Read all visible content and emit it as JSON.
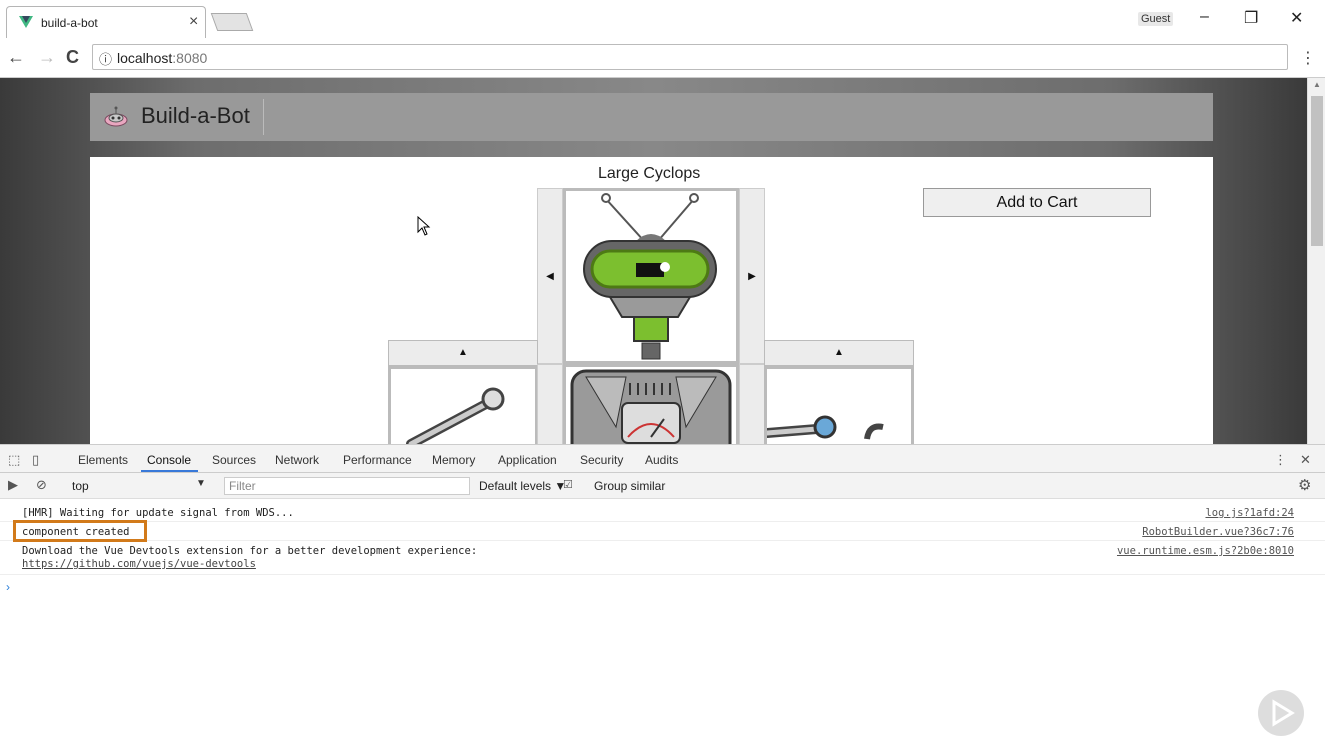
{
  "browser": {
    "tab_title": "build-a-bot",
    "tab_close": "×",
    "profile": "Guest",
    "minimize": "–",
    "restore": "❐",
    "close": "✕",
    "back": "←",
    "forward": "→",
    "reload": "C",
    "info_icon": "ⓘ",
    "url_host": "localhost",
    "url_port": ":8080",
    "menu": "⋮"
  },
  "page": {
    "brand": "Build-a-Bot",
    "robot_name": "Large Cyclops",
    "add_to_cart": "Add to Cart",
    "arrow_left": "◀",
    "arrow_right": "▶",
    "arrow_up": "▲"
  },
  "devtools": {
    "tabs": [
      "Elements",
      "Console",
      "Sources",
      "Network",
      "Performance",
      "Memory",
      "Application",
      "Security",
      "Audits"
    ],
    "active_tab": "Console",
    "context": "top",
    "filter_placeholder": "Filter",
    "levels": "Default levels ▼",
    "group_similar": "Group similar",
    "logs": [
      {
        "message": "[HMR] Waiting for update signal from WDS...",
        "source": "log.js?1afd:24"
      },
      {
        "message": "component created",
        "source": "RobotBuilder.vue?36c7:76"
      },
      {
        "message": "Download the Vue Devtools extension for a better development experience:",
        "link": "https://github.com/vuejs/vue-devtools",
        "source": "vue.runtime.esm.js?2b0e:8010"
      }
    ],
    "prompt": "›"
  },
  "colors": {
    "highlight": "#d27a1a",
    "vue_green": "#41b883",
    "robot_green": "#7cbf2f"
  }
}
